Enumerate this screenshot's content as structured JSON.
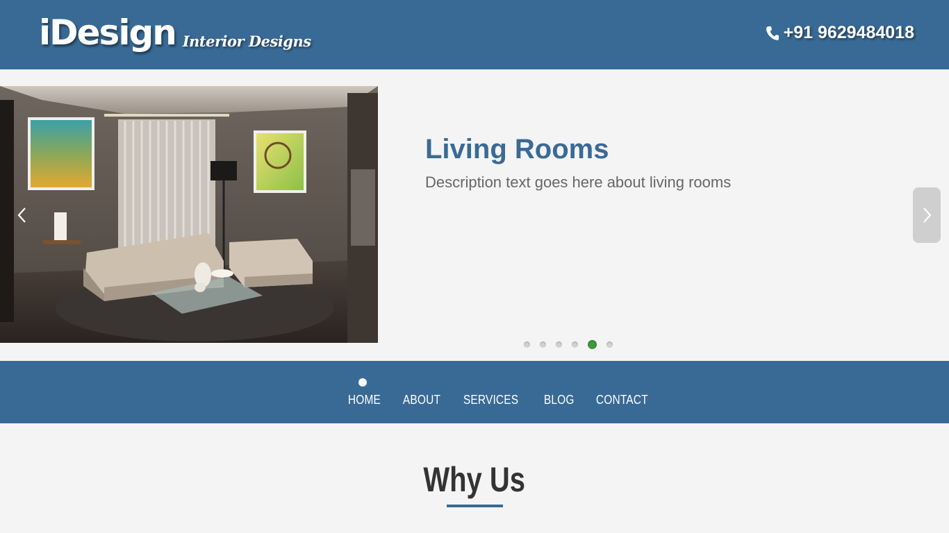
{
  "header": {
    "logo_main": "iDesign",
    "logo_sub": "Interior Designs",
    "phone": "+91 9629484018",
    "icons": {
      "phone": "phone-icon"
    }
  },
  "slider": {
    "title": "Living Rooms",
    "description": "Description text goes here about living rooms",
    "dots_count": 6,
    "active_dot": 5,
    "prev_icon": "chevron-left-icon",
    "next_icon": "chevron-right-icon"
  },
  "nav": {
    "items": [
      {
        "label": "HOME"
      },
      {
        "label": "ABOUT"
      },
      {
        "label": "SERVICES"
      },
      {
        "label": "BLOG"
      },
      {
        "label": "CONTACT"
      }
    ]
  },
  "section": {
    "title": "Why Us"
  },
  "colors": {
    "brand_blue": "#386a95",
    "active_dot": "#3f9a3f",
    "title_blue": "#3a6a95"
  }
}
